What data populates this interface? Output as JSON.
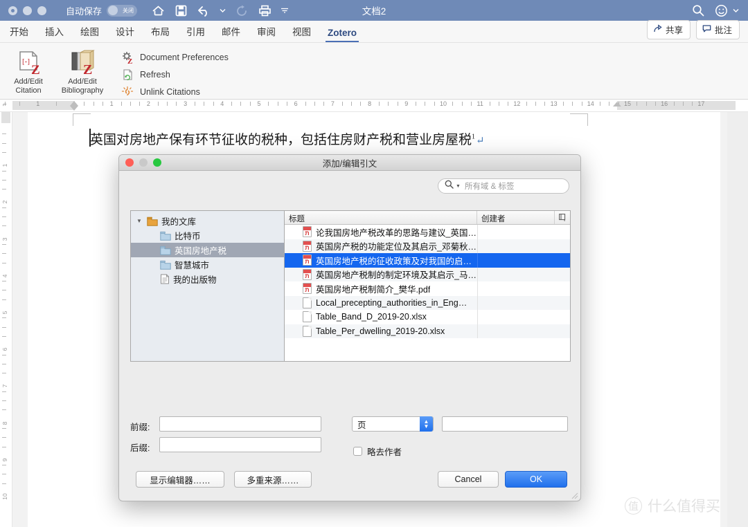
{
  "titlebar": {
    "autosave_label": "自动保存",
    "autosave_state": "关闭",
    "document_title": "文档2",
    "icons": [
      "home-icon",
      "save-icon",
      "undo-icon",
      "redo-icon",
      "print-icon",
      "customize-icon"
    ],
    "search_icon": "search-icon",
    "account_icon": "smiley-icon"
  },
  "ribbon": {
    "tabs": [
      {
        "label": "开始",
        "active": false
      },
      {
        "label": "插入",
        "active": false
      },
      {
        "label": "绘图",
        "active": false
      },
      {
        "label": "设计",
        "active": false
      },
      {
        "label": "布局",
        "active": false
      },
      {
        "label": "引用",
        "active": false
      },
      {
        "label": "邮件",
        "active": false
      },
      {
        "label": "审阅",
        "active": false
      },
      {
        "label": "视图",
        "active": false
      },
      {
        "label": "Zotero",
        "active": true
      }
    ],
    "share_label": "共享",
    "comments_label": "批注",
    "big_buttons": [
      {
        "line1": "Add/Edit",
        "line2": "Citation",
        "icon": "add-edit-citation-icon"
      },
      {
        "line1": "Add/Edit",
        "line2": "Bibliography",
        "icon": "add-edit-bibliography-icon"
      }
    ],
    "small_buttons": [
      {
        "label": "Document Preferences",
        "icon": "gear-z-icon"
      },
      {
        "label": "Refresh",
        "icon": "refresh-icon"
      },
      {
        "label": "Unlink Citations",
        "icon": "unlink-icon"
      }
    ]
  },
  "ruler": {
    "horizontal_numbers": [
      1,
      1,
      2,
      3,
      4,
      5,
      6,
      7,
      8,
      9,
      10,
      11,
      12,
      13,
      14,
      15,
      16,
      17
    ],
    "vertical_numbers": [
      1,
      2,
      3,
      4,
      5,
      6,
      7,
      8,
      9,
      10
    ]
  },
  "document": {
    "text": "英国对房地产保有环节征收的税种，包括住房财产税和营业房屋税",
    "footnote_marker": "1",
    "paragraph_mark": "↵"
  },
  "watermark": {
    "mark": "值",
    "text": "什么值得买"
  },
  "dialog": {
    "title": "添加/编辑引文",
    "search_placeholder": "所有域 & 标签",
    "search_icon": "search-icon",
    "tree": [
      {
        "label": "我的文库",
        "level": 0,
        "icon": "library-icon",
        "twisty": "▼",
        "selected": false
      },
      {
        "label": "比特币",
        "level": 1,
        "icon": "folder-icon",
        "twisty": "",
        "selected": false
      },
      {
        "label": "英国房地产税",
        "level": 1,
        "icon": "folder-icon",
        "twisty": "",
        "selected": true
      },
      {
        "label": "智慧城市",
        "level": 1,
        "icon": "folder-icon",
        "twisty": "",
        "selected": false
      },
      {
        "label": "我的出版物",
        "level": 1,
        "icon": "document-icon",
        "twisty": "",
        "selected": false
      }
    ],
    "columns": {
      "title": "标题",
      "creator": "创建者",
      "picker_icon": "column-picker-icon"
    },
    "items": [
      {
        "title": "论我国房地产税改革的思路与建议_英国…",
        "creator": "",
        "icon": "pdf-icon",
        "selected": false
      },
      {
        "title": "英国房产税的功能定位及其启示_邓菊秋…",
        "creator": "",
        "icon": "pdf-icon",
        "selected": false
      },
      {
        "title": "英国房地产税的征收政策及对我国的启…",
        "creator": "",
        "icon": "pdf-icon",
        "selected": true
      },
      {
        "title": "英国房地产税制的制定环境及其启示_马…",
        "creator": "",
        "icon": "pdf-icon",
        "selected": false
      },
      {
        "title": "英国房地产税制简介_樊华.pdf",
        "creator": "",
        "icon": "pdf-icon",
        "selected": false
      },
      {
        "title": "Local_precepting_authorities_in_Eng…",
        "creator": "",
        "icon": "file-icon",
        "selected": false
      },
      {
        "title": "Table_Band_D_2019-20.xlsx",
        "creator": "",
        "icon": "file-icon",
        "selected": false
      },
      {
        "title": "Table_Per_dwelling_2019-20.xlsx",
        "creator": "",
        "icon": "file-icon",
        "selected": false
      }
    ],
    "form": {
      "prefix_label": "前缀:",
      "prefix_value": "",
      "suffix_label": "后缀:",
      "suffix_value": "",
      "locator_type": "页",
      "locator_value": "",
      "suppress_author_label": "略去作者",
      "suppress_author_checked": false
    },
    "buttons": {
      "show_editor": "显示编辑器……",
      "multiple_sources": "多重来源……",
      "cancel": "Cancel",
      "ok": "OK"
    }
  },
  "colors": {
    "titlebar_bg": "#6f8ab7",
    "accent_blue": "#1466ef",
    "tab_active": "#2e4a80",
    "selection_gray": "#a0a7b4"
  }
}
